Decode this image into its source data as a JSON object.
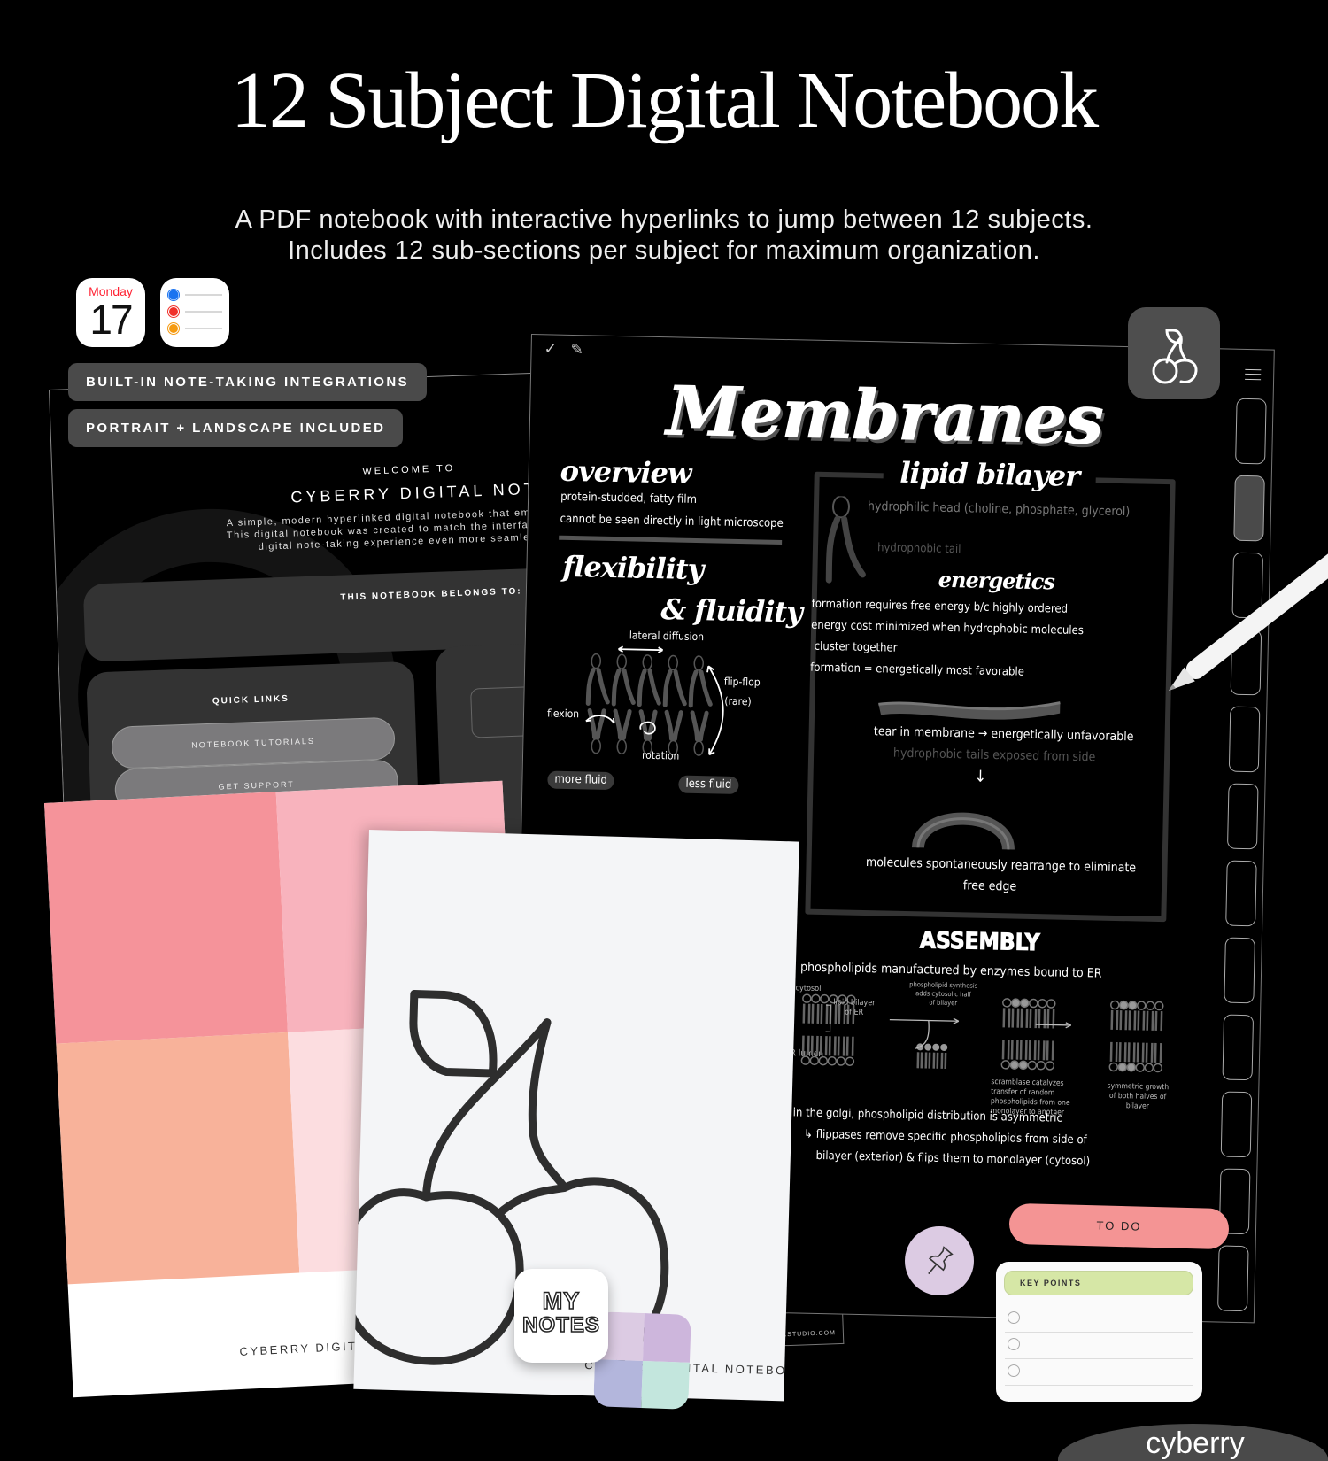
{
  "header": {
    "title": "12 Subject Digital Notebook",
    "subtitle_line1": "A PDF notebook with interactive hyperlinks to jump between 12 subjects.",
    "subtitle_line2": "Includes 12 sub-sections per subject for maximum organization."
  },
  "integrations": {
    "calendar_day": "Monday",
    "calendar_date": "17",
    "reminder_colors": [
      "#1a73f0",
      "#f0302a",
      "#f59a10"
    ]
  },
  "badges": [
    "BUILT-IN NOTE-TAKING INTEGRATIONS",
    "PORTRAIT + LANDSCAPE INCLUDED"
  ],
  "welcome_page": {
    "welcome": "WELCOME TO",
    "name": "CYBERRY DIGITAL NOTEBOOK",
    "description": [
      "A simple, modern hyperlinked digital notebook that emulates t",
      "This digital notebook was created to match the interface of yo",
      "digital note-taking experience even more seamless"
    ],
    "belongs_to": "THIS NOTEBOOK BELONGS TO:",
    "quick_links": "QUICK LINKS",
    "buttons": [
      "NOTEBOOK TUTORIALS",
      "GET SUPPORT"
    ]
  },
  "notes_page": {
    "title": "Membranes",
    "overview": {
      "heading": "overview",
      "bullets": [
        "protein-studded, fatty film",
        "cannot be seen directly in light microscope"
      ]
    },
    "flexibility": {
      "heading1": "flexibility",
      "heading2": "& fluidity",
      "lateral": "lateral diffusion",
      "flipflop": "flip-flop",
      "rare": "(rare)",
      "flexion": "flexion",
      "rotation": "rotation",
      "more": "more fluid",
      "less": "less fluid"
    },
    "partial": [
      "tion",
      "ol",
      "ens"
    ],
    "lipid_bilayer": {
      "heading": "lipid bilayer",
      "head": "hydrophilic head (choline, phosphate, glycerol)",
      "tail": "hydrophobic tail",
      "energetics": "energetics",
      "bullets": [
        "formation requires free energy b/c highly ordered",
        "energy cost minimized when hydrophobic molecules",
        "cluster together",
        "formation = energetically most favorable"
      ],
      "tear": "tear in membrane → energetically unfavorable",
      "exposed": "hydrophobic tails exposed from side",
      "down_arrow": "↓",
      "rearrange1": "molecules spontaneously rearrange to eliminate",
      "rearrange2": "free edge"
    },
    "assembly": {
      "heading": "ASSEMBLY",
      "bullet": "phospholipids manufactured by enzymes bound to ER",
      "cytosol": "cytosol",
      "er_lumen": "ER lumen",
      "bilayer_er": [
        "lipid bilayer",
        "of ER"
      ],
      "synthesis": [
        "phospholipid synthesis",
        "adds cytosolic half",
        "of bilayer"
      ],
      "scramblase": [
        "scramblase catalyzes",
        "transfer of random",
        "phospholipids from one",
        "monolayer to another"
      ],
      "symmetric": [
        "symmetric growth",
        "of both halves of",
        "bilayer"
      ],
      "golgi": [
        "in the golgi, phospholipid distribution is asymmetric",
        "↳ flippases remove specific phospholipids from side of",
        "bilayer (exterior) & flips them to monolayer (cytosol)"
      ]
    },
    "tab_count": 12,
    "active_tab": 2
  },
  "back_page_url": "ALSTUDIO.COM",
  "widgets": {
    "todo": "TO DO",
    "key_points": "KEY POINTS",
    "key_point_rows": 3,
    "todo_color": "#f49494",
    "key_color": "#d6e7a6",
    "pin_color": "#dccbe3"
  },
  "covers": {
    "pink_footer": "CYBERRY DIGITAL NOTEBOOK",
    "white_footer": "CYBERRY DIGITAL NOTEBOOK",
    "pink_colors": [
      "#f5939a",
      "#f8b3bd",
      "#f8b29a",
      "#fcdde0"
    ],
    "my_notes": [
      "MY",
      "NOTES"
    ],
    "palette": [
      "#dccbe3",
      "#cdb6dc",
      "#b3b6dc",
      "#c3e6dd"
    ]
  },
  "brand": "cyberry"
}
